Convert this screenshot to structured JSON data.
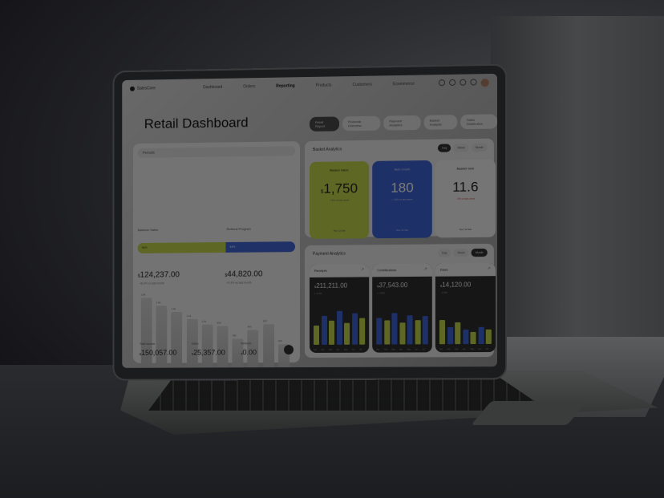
{
  "topbar": {
    "brand": "SalesCore",
    "nav": [
      "Dashboard",
      "Orders",
      "Reporting",
      "Products",
      "Customers",
      "Ecommerce"
    ],
    "active_nav": "Reporting"
  },
  "page": {
    "title": "Retail Dashboard",
    "tabs": [
      "Retail Report",
      "Financial Overview",
      "Payment Analytics",
      "Basket Analysis",
      "Sales Distribution"
    ]
  },
  "left": {
    "dropdown": "Periods",
    "balance_label": "Balance Sales",
    "referral_label": "Referral Program",
    "seg_a": "56%",
    "seg_b": "44%",
    "balance_value": "124,237.00",
    "balance_note": "+8.2% vs last month",
    "referral_value": "44,820.00",
    "referral_note": "+2.4% vs last month",
    "bars": [
      {
        "lbl": "1,8k",
        "x": "January",
        "v": 1.0
      },
      {
        "lbl": "1,6k",
        "x": "February",
        "v": 0.89
      },
      {
        "lbl": "1,4k",
        "x": "March",
        "v": 0.8
      },
      {
        "lbl": "1,2k",
        "x": "April",
        "v": 0.7
      },
      {
        "lbl": "1,0k",
        "x": "May",
        "v": 0.62
      },
      {
        "lbl": "950",
        "x": "June",
        "v": 0.6
      },
      {
        "lbl": "780",
        "x": "July",
        "v": 0.42
      },
      {
        "lbl": "900",
        "x": "August",
        "v": 0.55
      },
      {
        "lbl": "920",
        "x": "September",
        "v": 0.62
      },
      {
        "lbl": "620",
        "x": "October",
        "v": 0.34
      }
    ],
    "foot": [
      {
        "label": "Total Income",
        "value": "150,057.00"
      },
      {
        "label": "Sales",
        "value": "25,357.00"
      },
      {
        "label": "Refunds",
        "value": "0.00"
      }
    ]
  },
  "basket": {
    "title": "Basket Analytics",
    "periods": [
      "Day",
      "Week",
      "Month"
    ],
    "active_period": "Day",
    "stats": [
      {
        "title": "Basket Value",
        "value": "1,750",
        "prefix": "$",
        "note": "+ 8% vs last week",
        "foot": "Nov 12 Sat",
        "color": "#c3d84a"
      },
      {
        "title": "Item Count",
        "value": "180",
        "prefix": "",
        "note": "+ 12% vs last week",
        "foot": "Nov 12 Sat",
        "color": "#3d63d6"
      },
      {
        "title": "Basket Size",
        "value": "11.6",
        "prefix": "",
        "note": "- 3% vs last week",
        "foot": "Nov 12 Sat",
        "color": "#f3f3f3"
      }
    ]
  },
  "payment": {
    "title": "Payment Analytics",
    "periods": [
      "Day",
      "Week",
      "Month"
    ],
    "active_period": "Month",
    "cards": [
      {
        "title": "Receipts",
        "value": "211,211.00",
        "note": "+ 4.2%"
      },
      {
        "title": "Contributions",
        "value": "37,543.00",
        "note": "+ 1.8%"
      },
      {
        "title": "Dues",
        "value": "14,120.00",
        "note": "- 2.1%"
      }
    ],
    "months": [
      "Jan",
      "Feb",
      "Mar",
      "Apr",
      "May",
      "Jun",
      "Jul"
    ]
  }
}
